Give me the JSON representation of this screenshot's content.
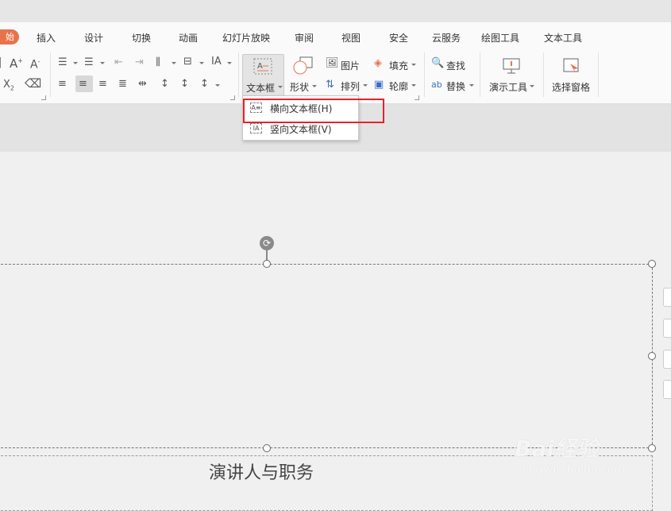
{
  "menu": {
    "start_tab": "始",
    "tabs": [
      "插入",
      "设计",
      "切换",
      "动画",
      "幻灯片放映",
      "审阅",
      "视图",
      "安全",
      "云服务",
      "绘图工具",
      "文本工具"
    ]
  },
  "ribbon": {
    "textbox_label": "文本框",
    "shape_label": "形状",
    "picture_label": "图片",
    "arrange_label": "排列",
    "fill_label": "填充",
    "outline_label": "轮廓",
    "find_label": "查找",
    "replace_label": "替换",
    "present_tools_label": "演示工具",
    "selection_pane_label": "选择窗格"
  },
  "textbox_menu": {
    "items": [
      "横向文本框(H)",
      "竖向文本框(V)"
    ],
    "highlighted_index": 0
  },
  "slide": {
    "subtitle": "演讲人与职务"
  },
  "watermark": {
    "logo": "Bai経验",
    "url": "jingyan.baidu.com"
  },
  "colors": {
    "accent_orange": "#e8734a",
    "highlight_red": "#e8222a"
  }
}
